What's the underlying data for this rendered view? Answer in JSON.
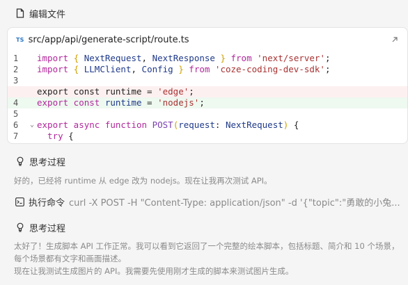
{
  "edit_header": {
    "label": "编辑文件"
  },
  "file_card": {
    "badge": "TS",
    "path": "src/app/api/generate-script/route.ts",
    "lines": [
      {
        "num": "1",
        "status": "",
        "fold": "",
        "tokens": [
          {
            "t": "import ",
            "c": "kw"
          },
          {
            "t": "{ ",
            "c": "br"
          },
          {
            "t": "NextRequest",
            "c": "ty"
          },
          {
            "t": ", ",
            "c": "src"
          },
          {
            "t": "NextResponse",
            "c": "ty"
          },
          {
            "t": " }",
            "c": "br"
          },
          {
            "t": " from ",
            "c": "kw"
          },
          {
            "t": "'next/server'",
            "c": "str"
          },
          {
            "t": ";",
            "c": "src"
          }
        ]
      },
      {
        "num": "2",
        "status": "",
        "fold": "",
        "tokens": [
          {
            "t": "import ",
            "c": "kw"
          },
          {
            "t": "{ ",
            "c": "br"
          },
          {
            "t": "LLMClient",
            "c": "ty"
          },
          {
            "t": ", ",
            "c": "src"
          },
          {
            "t": "Config",
            "c": "ty"
          },
          {
            "t": " }",
            "c": "br"
          },
          {
            "t": " from ",
            "c": "kw"
          },
          {
            "t": "'coze-coding-dev-sdk'",
            "c": "str"
          },
          {
            "t": ";",
            "c": "src"
          }
        ]
      },
      {
        "num": "3",
        "status": "",
        "fold": "",
        "tokens": []
      },
      {
        "num": "",
        "status": "removed",
        "fold": "",
        "tokens": [
          {
            "t": "export const runtime = ",
            "c": "src"
          },
          {
            "t": "'edge'",
            "c": "str"
          },
          {
            "t": ";",
            "c": "src"
          }
        ]
      },
      {
        "num": "4",
        "status": "added",
        "fold": "",
        "tokens": [
          {
            "t": "export const ",
            "c": "kw"
          },
          {
            "t": "runtime",
            "c": "ty"
          },
          {
            "t": " = ",
            "c": "src"
          },
          {
            "t": "'nodejs'",
            "c": "str"
          },
          {
            "t": ";",
            "c": "src"
          }
        ]
      },
      {
        "num": "5",
        "status": "",
        "fold": "",
        "tokens": []
      },
      {
        "num": "6",
        "status": "",
        "fold": "⌄",
        "tokens": [
          {
            "t": "export async function ",
            "c": "kw"
          },
          {
            "t": "POST",
            "c": "fn"
          },
          {
            "t": "(",
            "c": "br"
          },
          {
            "t": "request",
            "c": "ty"
          },
          {
            "t": ": ",
            "c": "src"
          },
          {
            "t": "NextRequest",
            "c": "ty"
          },
          {
            "t": ")",
            "c": "br"
          },
          {
            "t": " {",
            "c": "src"
          }
        ]
      },
      {
        "num": "7",
        "status": "",
        "fold": "",
        "tokens": [
          {
            "t": "  try ",
            "c": "kw"
          },
          {
            "t": "{",
            "c": "src"
          }
        ]
      }
    ]
  },
  "thinking1": {
    "label": "思考过程",
    "text": "好的，已经将 runtime 从 edge 改为 nodejs。现在让我再次测试 API。"
  },
  "exec": {
    "label": "执行命令",
    "command": "curl -X POST -H \"Content-Type: application/json\" -d '{\"topic\":\"勇敢的小兔..."
  },
  "thinking2": {
    "label": "思考过程",
    "text1": "太好了！生成脚本 API 工作正常。我可以看到它返回了一个完整的绘本脚本，包括标题、简介和 10 个场景，每个场景都有文字和画面描述。",
    "text2": "现在让我测试生成图片的 API。我需要先使用刚才生成的脚本来测试图片生成。"
  }
}
